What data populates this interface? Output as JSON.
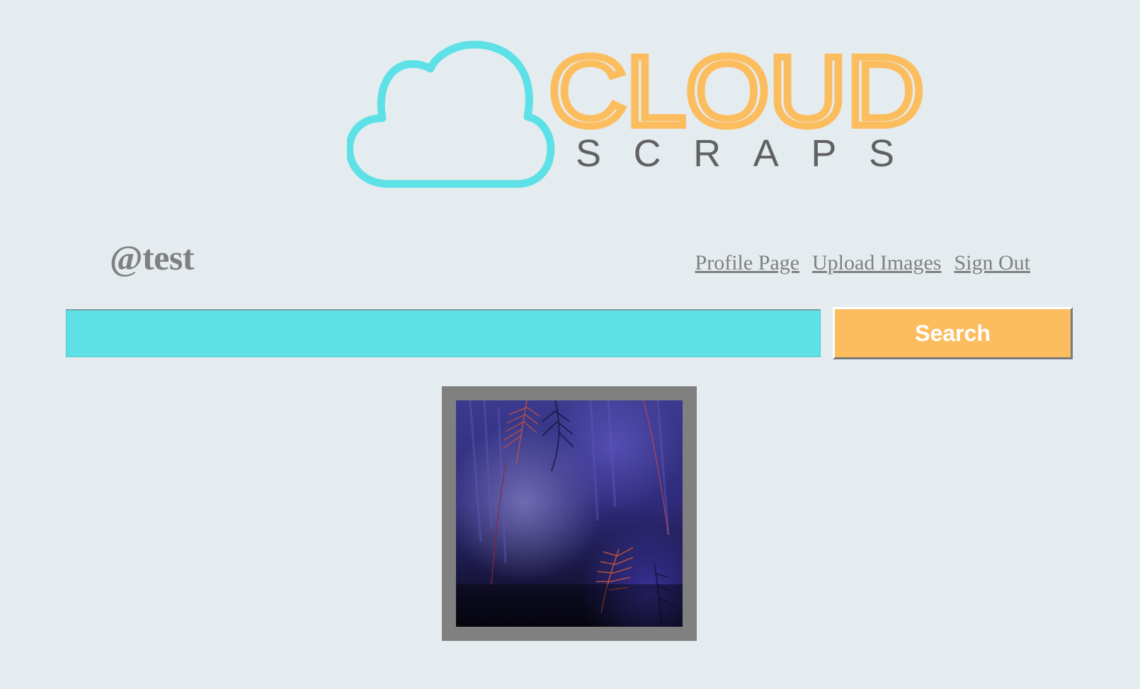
{
  "logo": {
    "word_main": "CLOUD",
    "word_sub": "SCRAPS",
    "cloud_color": "#5ee1e6",
    "main_color": "#fcbd5e",
    "sub_color": "#616161"
  },
  "header": {
    "username": "@test"
  },
  "nav": {
    "profile_label": "Profile Page",
    "upload_label": "Upload Images",
    "signout_label": "Sign Out"
  },
  "search": {
    "value": "",
    "placeholder": "",
    "button_label": "Search"
  },
  "gallery": {
    "items": [
      {
        "icon": "abstract-image"
      }
    ]
  },
  "colors": {
    "background": "#e5ecf0",
    "search_field": "#5ee1e6",
    "search_button": "#fcbd5e",
    "frame": "#808080",
    "link": "#808080"
  }
}
